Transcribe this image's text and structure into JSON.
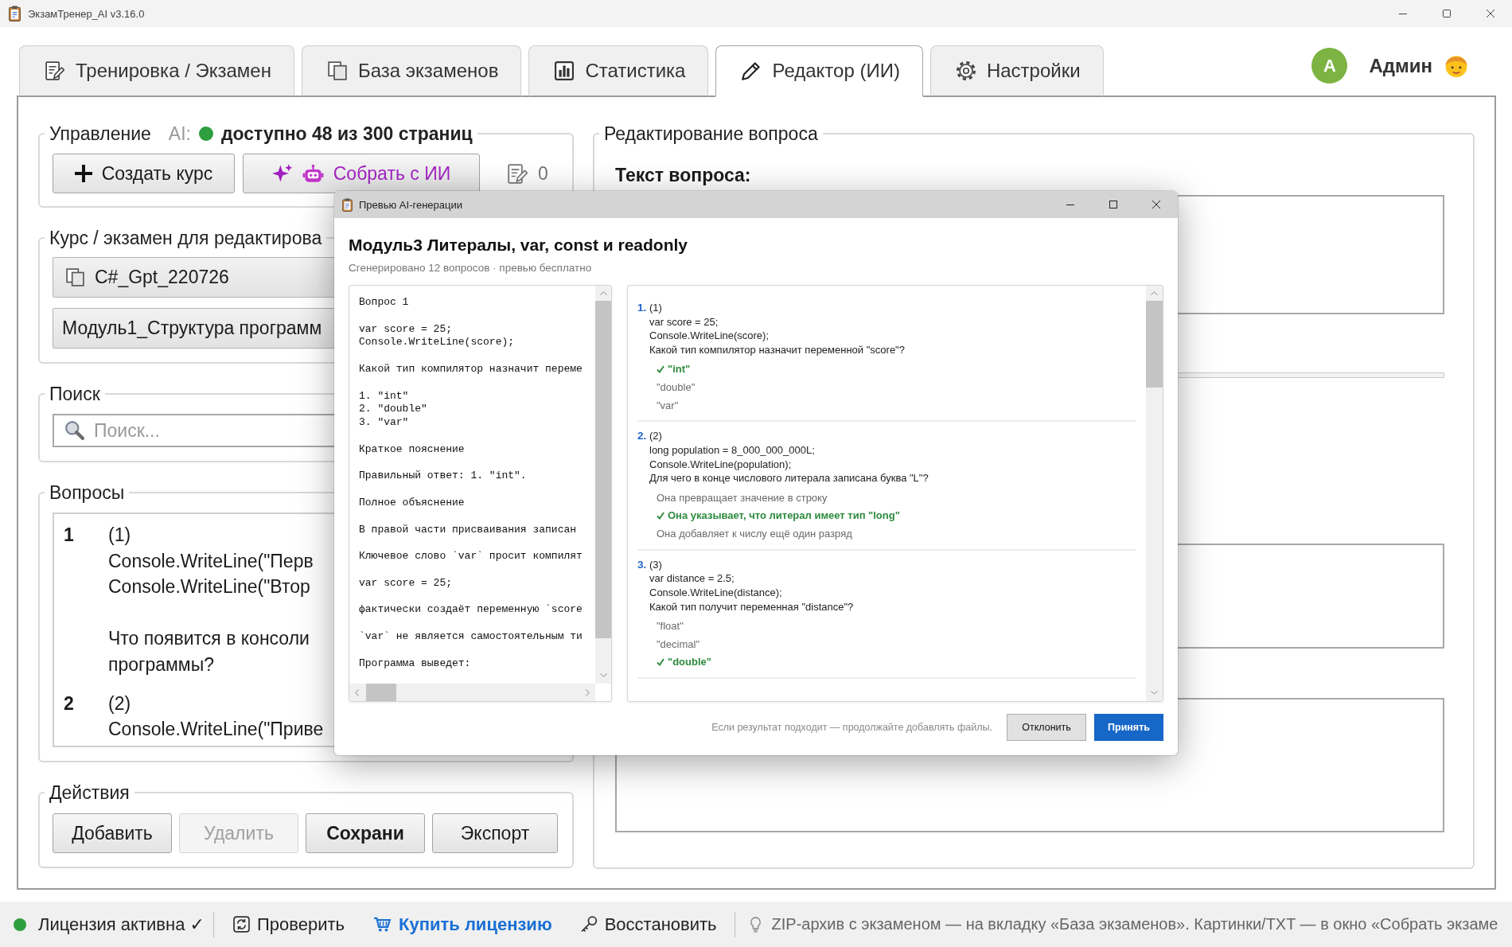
{
  "window": {
    "title": "ЭкзамТренер_AI v3.16.0"
  },
  "tabs": [
    {
      "label": "Тренировка / Экзамен",
      "selected": false
    },
    {
      "label": "База экзаменов",
      "selected": false
    },
    {
      "label": "Статистика",
      "selected": false
    },
    {
      "label": "Редактор (ИИ)",
      "selected": true
    },
    {
      "label": "Настройки",
      "selected": false
    }
  ],
  "user": {
    "avatar_letter": "А",
    "name": "Админ"
  },
  "control_group": {
    "title": "Управление",
    "ai_label": "AI:",
    "ai_online": true,
    "ai_quota": "доступно 48 из 300 страниц",
    "buttons": [
      {
        "label": "Создать курс",
        "kind": "create"
      },
      {
        "label": "Собрать с ИИ",
        "kind": "ai"
      }
    ],
    "file_count": "0"
  },
  "course_group": {
    "title": "Курс / экзамен для редактирова",
    "course": "C#_Gpt_220726",
    "module": "Модуль1_Структура программ"
  },
  "search_group": {
    "title": "Поиск",
    "placeholder": "Поиск..."
  },
  "questions_group": {
    "title": "Вопросы",
    "items": [
      {
        "number": "1",
        "blocks": [
          [
            "(1)",
            "Console.WriteLine(\"Перв",
            "Console.WriteLine(\"Втор"
          ],
          [
            "Что появится в консоли",
            "программы?"
          ]
        ]
      },
      {
        "number": "2",
        "blocks": [
          [
            "(2)",
            "Console.WriteLine(\"Приве"
          ]
        ]
      }
    ]
  },
  "actions_group": {
    "title": "Действия",
    "buttons": [
      {
        "label": "Добавить",
        "disabled": false,
        "default": false
      },
      {
        "label": "Удалить",
        "disabled": true,
        "default": false
      },
      {
        "label": "Сохрани",
        "disabled": false,
        "default": true
      },
      {
        "label": "Экспорт",
        "disabled": false,
        "default": false
      }
    ]
  },
  "editor_group": {
    "title": "Редактирование вопроса",
    "text_label": "Текст вопроса:"
  },
  "preview_dialog": {
    "title": "Превью AI-генерации",
    "heading": "Модуль3 Литералы, var, const и readonly",
    "summary": "Сгенерировано 12 вопросов · превью бесплатно",
    "source_blocks": [
      [
        "Вопрос 1"
      ],
      [
        "var score = 25;",
        "Console.WriteLine(score);"
      ],
      [
        "Какой тип компилятор назначит переме"
      ],
      [
        "1. \"int\"",
        "2. \"double\"",
        "3. \"var\""
      ],
      [
        "Краткое пояснение"
      ],
      [
        "Правильный ответ: 1. \"int\"."
      ],
      [
        "Полное объяснение"
      ],
      [
        "В правой части присваивания записан"
      ],
      [
        "Ключевое слово `var` просит компилят"
      ],
      [
        "var score = 25;"
      ],
      [
        "фактически создаёт переменную `score"
      ],
      [
        "`var` не является самостоятельным ти"
      ],
      [
        "Программа выведет:"
      ]
    ],
    "questions": [
      {
        "number": "1.",
        "tag": "(1)",
        "lines": [
          "var score = 25;",
          "Console.WriteLine(score);",
          "Какой тип компилятор назначит переменной \"score\"?"
        ],
        "options": [
          {
            "text": "\"int\"",
            "correct": true
          },
          {
            "text": "\"double\"",
            "correct": false
          },
          {
            "text": "\"var\"",
            "correct": false
          }
        ]
      },
      {
        "number": "2.",
        "tag": "(2)",
        "lines": [
          "long population = 8_000_000_000L;",
          "Console.WriteLine(population);",
          "Для чего в конце числового литерала записана буква \"L\"?"
        ],
        "options": [
          {
            "text": "Она превращает значение в строку",
            "correct": false
          },
          {
            "text": "Она указывает, что литерал имеет тип \"long\"",
            "correct": true
          },
          {
            "text": "Она добавляет к числу ещё один разряд",
            "correct": false
          }
        ]
      },
      {
        "number": "3.",
        "tag": "(3)",
        "lines": [
          "var distance = 2.5;",
          "Console.WriteLine(distance);",
          "Какой тип получит переменная \"distance\"?"
        ],
        "options": [
          {
            "text": "\"float\"",
            "correct": false
          },
          {
            "text": "\"decimal\"",
            "correct": false
          },
          {
            "text": "\"double\"",
            "correct": true
          }
        ]
      }
    ],
    "hint": "Если результат подходит — продолжайте добавлять файлы.",
    "buttons": [
      {
        "label": "Отклонить",
        "kind": "secondary"
      },
      {
        "label": "Принять",
        "kind": "primary"
      }
    ]
  },
  "status_bar": {
    "license": {
      "label": "Лицензия активна ✓",
      "active": true
    },
    "actions": [
      {
        "label": "Проверить",
        "kind": "check"
      },
      {
        "label": "Купить лицензию",
        "kind": "buy"
      },
      {
        "label": "Восстановить",
        "kind": "restore"
      }
    ],
    "tip": "ZIP-архив с экзаменом — на вкладку «База экзаменов». Картинки/TXT — в окно «Собрать экзаме"
  }
}
